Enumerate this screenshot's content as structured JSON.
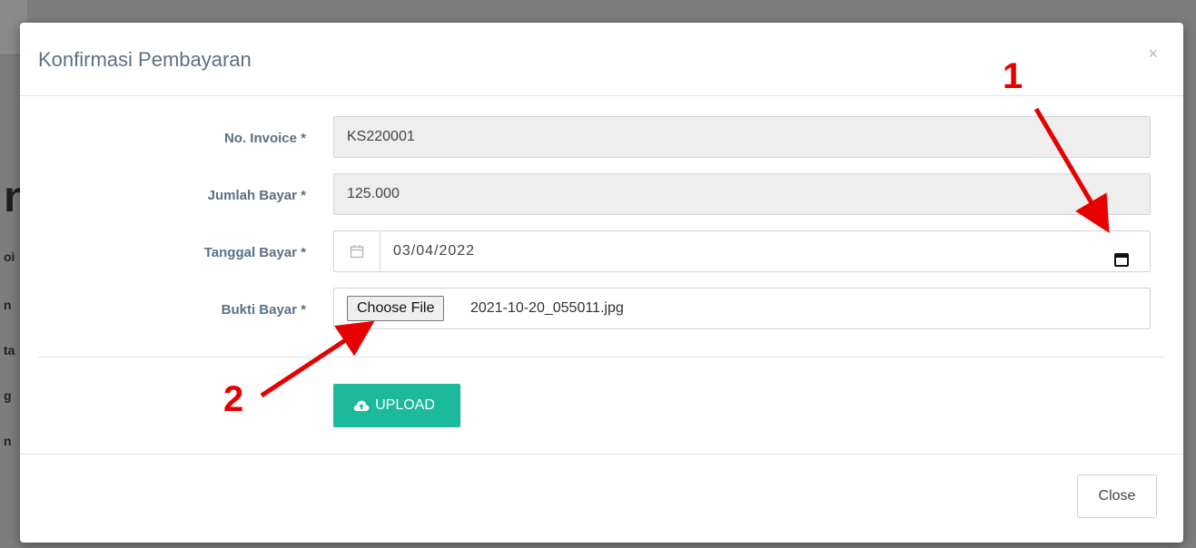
{
  "modal": {
    "title": "Konfirmasi Pembayaran",
    "close_x": "×"
  },
  "form": {
    "invoice": {
      "label": "No. Invoice *",
      "value": "KS220001"
    },
    "amount": {
      "label": "Jumlah Bayar *",
      "value": "125.000"
    },
    "date": {
      "label": "Tanggal Bayar *",
      "value": "03/04/2022"
    },
    "proof": {
      "label": "Bukti Bayar *",
      "button_label": "Choose File",
      "file_name": "2021-10-20_055011.jpg"
    }
  },
  "actions": {
    "upload_label": "UPLOAD",
    "close_label": "Close"
  },
  "annotations": {
    "marker_1": "1",
    "marker_2": "2"
  },
  "icons": {
    "date_prefix": "calendar-icon",
    "date_picker": "calendar-picker-icon",
    "upload": "cloud-upload-icon"
  },
  "colors": {
    "accent": "#1cb99a",
    "label": "#5a7185",
    "annotation": "#e60000"
  }
}
